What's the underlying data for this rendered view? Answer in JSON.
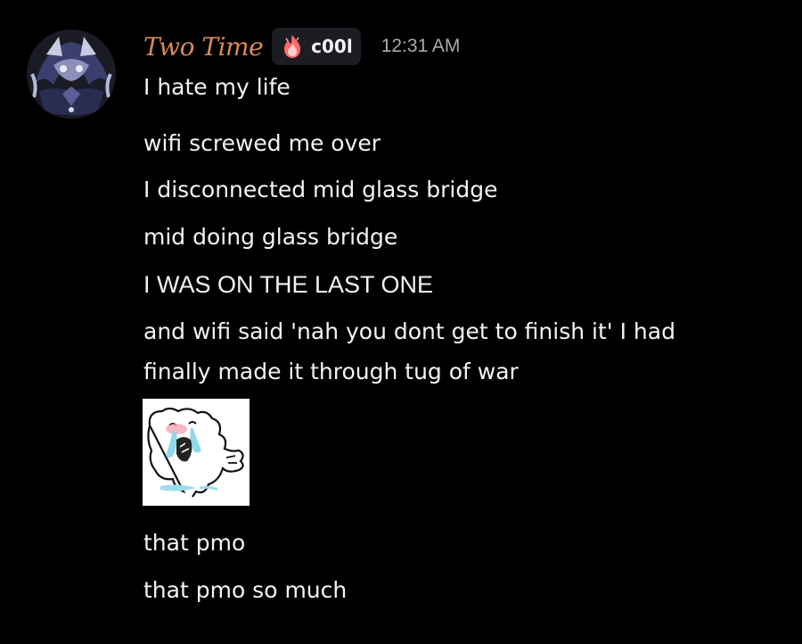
{
  "message_group": {
    "author": {
      "display_name": "Two Time",
      "name_color": "#d98a58",
      "tag_icon": "flame-icon",
      "tag_text": "c00l"
    },
    "timestamp": "12:31 AM",
    "messages": [
      "I hate my life",
      "wifi screwed me over",
      "I disconnected mid glass bridge",
      "mid doing glass bridge",
      "I WAS ON THE LAST ONE",
      "and wifi said 'nah you dont get to finish it' I had finally made it through tug of war",
      "that pmo",
      "that pmo so much"
    ],
    "sticker": {
      "icon": "crying-bear-sticker"
    }
  },
  "colors": {
    "background": "#000000",
    "text": "#f2f3f5",
    "timestamp": "#a8aab0",
    "tag_background": "#1c1d22"
  }
}
